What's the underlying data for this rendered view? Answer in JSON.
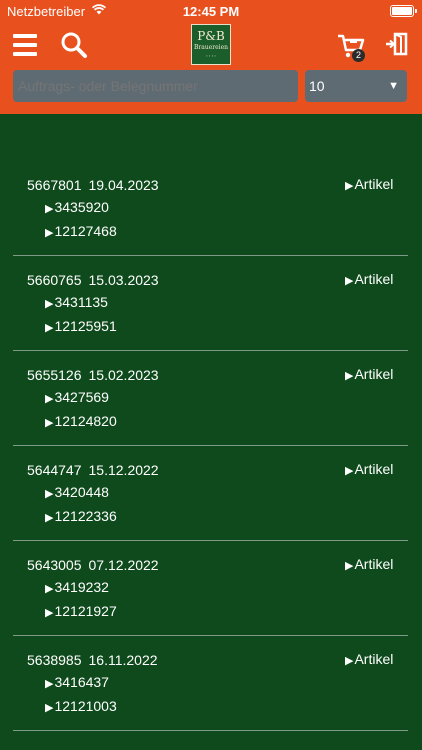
{
  "status_bar": {
    "carrier": "Netzbetreiber",
    "time": "12:45 PM"
  },
  "header": {
    "logo": {
      "text": "P&B",
      "subtext": "Brauereien",
      "tagline": "• • • •"
    },
    "cart_count": "2",
    "icons": {
      "menu": "menu-icon",
      "search": "search-icon",
      "cart": "cart-icon",
      "logout": "logout-icon"
    },
    "search": {
      "placeholder": "Auftrags- oder Belegnummer",
      "value": ""
    },
    "select": {
      "value": "10"
    },
    "colors": {
      "header_bg": "#e8501e",
      "content_bg": "#0e4a1c",
      "field_bg": "#5f6b73"
    }
  },
  "orders": [
    {
      "number": "5667801",
      "date": "19.04.2023",
      "artikel": "Artikel",
      "refs": [
        "3435920",
        "12127468"
      ]
    },
    {
      "number": "5660765",
      "date": "15.03.2023",
      "artikel": "Artikel",
      "refs": [
        "3431135",
        "12125951"
      ]
    },
    {
      "number": "5655126",
      "date": "15.02.2023",
      "artikel": "Artikel",
      "refs": [
        "3427569",
        "12124820"
      ]
    },
    {
      "number": "5644747",
      "date": "15.12.2022",
      "artikel": "Artikel",
      "refs": [
        "3420448",
        "12122336"
      ]
    },
    {
      "number": "5643005",
      "date": "07.12.2022",
      "artikel": "Artikel",
      "refs": [
        "3419232",
        "12121927"
      ]
    },
    {
      "number": "5638985",
      "date": "16.11.2022",
      "artikel": "Artikel",
      "refs": [
        "3416437",
        "12121003"
      ]
    }
  ]
}
